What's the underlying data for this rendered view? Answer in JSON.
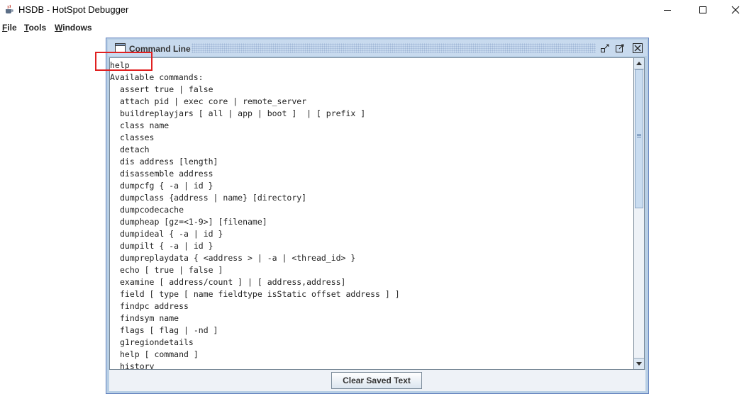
{
  "window": {
    "title": "HSDB - HotSpot Debugger",
    "icon": "java-cup-icon"
  },
  "menubar": {
    "items": [
      {
        "mnemonic": "F",
        "rest": "ile",
        "name": "File"
      },
      {
        "mnemonic": "T",
        "rest": "ools",
        "name": "Tools"
      },
      {
        "mnemonic": "W",
        "rest": "indows",
        "name": "Windows"
      }
    ]
  },
  "command_line": {
    "title": "Command Line",
    "clear_button_label": "Clear Saved Text",
    "lines": [
      {
        "text": "help",
        "indent": false
      },
      {
        "text": "Available commands:",
        "indent": false
      },
      {
        "text": "assert true | false",
        "indent": true
      },
      {
        "text": "attach pid | exec core | remote_server",
        "indent": true
      },
      {
        "text": "buildreplayjars [ all | app | boot ]  | [ prefix ]",
        "indent": true
      },
      {
        "text": "class name",
        "indent": true
      },
      {
        "text": "classes",
        "indent": true
      },
      {
        "text": "detach",
        "indent": true
      },
      {
        "text": "dis address [length]",
        "indent": true
      },
      {
        "text": "disassemble address",
        "indent": true
      },
      {
        "text": "dumpcfg { -a | id }",
        "indent": true
      },
      {
        "text": "dumpclass {address | name} [directory]",
        "indent": true
      },
      {
        "text": "dumpcodecache",
        "indent": true
      },
      {
        "text": "dumpheap [gz=<1-9>] [filename]",
        "indent": true
      },
      {
        "text": "dumpideal { -a | id }",
        "indent": true
      },
      {
        "text": "dumpilt { -a | id }",
        "indent": true
      },
      {
        "text": "dumpreplaydata { <address > | -a | <thread_id> }",
        "indent": true
      },
      {
        "text": "echo [ true | false ]",
        "indent": true
      },
      {
        "text": "examine [ address/count ] | [ address,address]",
        "indent": true
      },
      {
        "text": "field [ type [ name fieldtype isStatic offset address ] ]",
        "indent": true
      },
      {
        "text": "findpc address",
        "indent": true
      },
      {
        "text": "findsym name",
        "indent": true
      },
      {
        "text": "flags [ flag | -nd ]",
        "indent": true
      },
      {
        "text": "g1regiondetails",
        "indent": true
      },
      {
        "text": "help [ command ]",
        "indent": true
      },
      {
        "text": "history",
        "indent": true
      }
    ]
  },
  "colors": {
    "highlight": "#e02020",
    "frame_border": "#6382bf"
  }
}
